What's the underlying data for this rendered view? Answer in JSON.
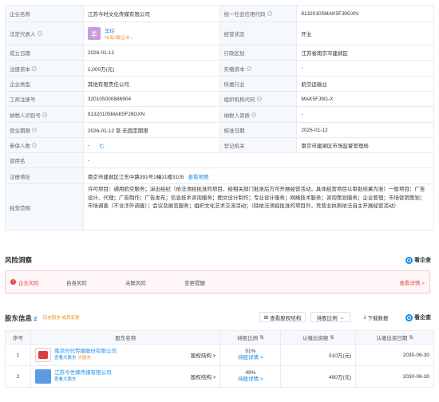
{
  "company": {
    "name_label": "企业名称",
    "name": "江苏今时文化传媒有限公司",
    "credit_label": "统一社会信用代码",
    "credit_code": "91320105MAK5FJ9GXN",
    "legal_label": "法定代表人",
    "legal_avatar": "羊",
    "legal_name": "羊玲",
    "legal_sub": "TA有3家企业",
    "status_label": "经营状态",
    "status": "开业",
    "founded_label": "成立日期",
    "founded": "2026-01-12",
    "region_label": "行政区划",
    "region": "江苏省南京市建邺区",
    "capital_label": "注册资本",
    "capital": "1,000万(元)",
    "paid_label": "实缴资本",
    "paid": "-",
    "type_label": "企业类型",
    "type": "其他有限责任公司",
    "industry_label": "所属行业",
    "industry": "航空运输业",
    "reg_no_label": "工商注册号",
    "reg_no": "320105000886904",
    "org_label": "组织机构代码",
    "org": "MAK5FJ9G-X",
    "tax_label": "纳税人识别号",
    "tax": "91320105MAK5FJ9GXN",
    "tax_qual_label": "纳税人资质",
    "tax_qual": "-",
    "term_label": "营业期限",
    "term": "2026-01-12 至 无固定期限",
    "approve_label": "核准日期",
    "approve": "2026-01-12",
    "insured_label": "参保人数",
    "insured": "-",
    "insured_mark": "匕",
    "authority_label": "登记机关",
    "authority": "南京市建邺区市场监督管理局",
    "former_label": "曾用名",
    "former": "-",
    "address_label": "注册地址",
    "address": "南京市建邺区江东中路391号1幢31楼3105",
    "address_link": "查看地图",
    "scope_label": "经营范围",
    "scope": "许可项目：通用航空服务；演出经纪（依法须经批准的项目，经相关部门批准后方可开展经营活动，具体经营项目以审批结果为准）一般项目：广告设计、代理；广告制作；广告发布；信息技术咨询服务；图文设计制作；专业设计服务；网络技术服务；咨询策划服务；企业管理；市场营销策划；市场调查（不含涉外调查）；会议及展览服务；组织文化艺术交流活动；（除依法须经批准的项目外，凭营业执照依法自主开展经营活动）"
  },
  "risk": {
    "title": "风险洞察",
    "items": [
      "企业风险",
      "自身风险",
      "关联风险",
      "变更提醒"
    ],
    "more": "查看详情 >",
    "brand": "看企查"
  },
  "shareholders": {
    "title": "股东信息",
    "count": "2",
    "history": "历史股东 成员变更",
    "btn_graph": "查看股权结构",
    "btn_ratio": "持股比例",
    "btn_download": "下载数据",
    "brand": "看企查",
    "headers": [
      "序号",
      "股东名称",
      "持股比例",
      "认缴出资额",
      "认缴出资日期"
    ],
    "rows": [
      {
        "idx": "1",
        "name": "南京时代传媒股份有限公司",
        "sub_a": "查看大股东",
        "sub_b": "大股东",
        "penetrate": "股权结构 >",
        "pct": "51%",
        "pct_link": "持股详情 >",
        "amount": "510万(元)",
        "date": "2030-06-30"
      },
      {
        "idx": "2",
        "name": "江苏今世缘传媒有限公司",
        "sub_a": "查看大股东",
        "sub_b": "",
        "penetrate": "股权结构 >",
        "pct": "49%",
        "pct_link": "持股详情 >",
        "amount": "490万(元)",
        "date": "2030-06-30"
      }
    ]
  },
  "colors": {
    "link": "#128bed",
    "risk": "#e04a4a",
    "label_bg": "#f5f8fd"
  }
}
